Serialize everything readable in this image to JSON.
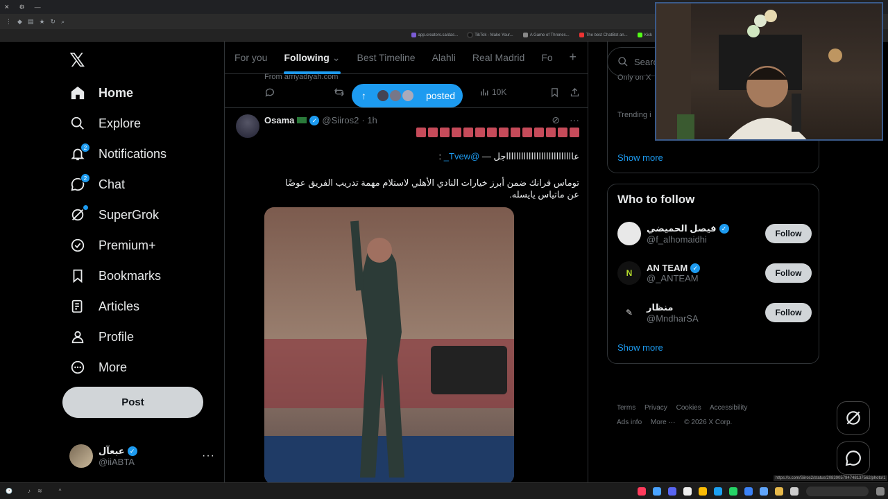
{
  "browser": {
    "bookmarks": [
      "app.creators.sa/das...",
      "TikTok - Make Your...",
      "A Game of Thrones...",
      "The best ChatBot an...",
      "Kick"
    ]
  },
  "nav": {
    "items": [
      {
        "label": "Home",
        "icon": "home-icon",
        "active": true
      },
      {
        "label": "Explore",
        "icon": "search-icon"
      },
      {
        "label": "Notifications",
        "icon": "bell-icon",
        "badge": "2"
      },
      {
        "label": "Chat",
        "icon": "chat-icon",
        "badge": "2"
      },
      {
        "label": "SuperGrok",
        "icon": "grok-icon",
        "dot": true
      },
      {
        "label": "Premium+",
        "icon": "premium-icon"
      },
      {
        "label": "Bookmarks",
        "icon": "bookmark-icon"
      },
      {
        "label": "Articles",
        "icon": "articles-icon"
      },
      {
        "label": "Profile",
        "icon": "profile-icon"
      },
      {
        "label": "More",
        "icon": "more-circle-icon"
      }
    ],
    "post_label": "Post",
    "account": {
      "display_name": "عبعآل",
      "handle": "@iiABTA"
    }
  },
  "tabs": {
    "items": [
      "For you",
      "Following",
      "Best Timeline",
      "Alahli",
      "Real Madrid",
      "Fo"
    ],
    "active": "Following"
  },
  "prev_post": {
    "from_text": "From arriyadiyah.com",
    "views": "10K",
    "posted_pill": "posted"
  },
  "tweet": {
    "name": "Osama",
    "handle": "@Siiros2",
    "time": "· 1h",
    "line1": "عاااااااااااااااااااااااااااجل — ",
    "mention": "@Tvew_",
    "line1_end": " :",
    "body": "توماس فرانك ضمن أبرز خيارات النادي الأهلي لاستلام مهمة تدريب الفريق عوضًا عن ماتياس يايسله."
  },
  "right": {
    "search_placeholder": "Search",
    "trend_fragment_1": "Only on X",
    "trend_fragment_2": "Trending i",
    "show_more": "Show more",
    "who_to_follow": "Who to follow",
    "follow_label": "Follow",
    "suggestions": [
      {
        "name": "فيصل الحميضي",
        "handle": "@f_alhomaidhi"
      },
      {
        "name": "AN TEAM",
        "handle": "@_ANTEAM"
      },
      {
        "name": "منظار",
        "handle": "@MndharSA"
      }
    ],
    "footer": [
      "Terms",
      "Privacy",
      "Cookies",
      "Accessibility",
      "Ads info",
      "More ···",
      "© 2026 X Corp."
    ]
  },
  "status_url": "https://x.com/Siiros2/status/2083905794748137562/photo/1"
}
